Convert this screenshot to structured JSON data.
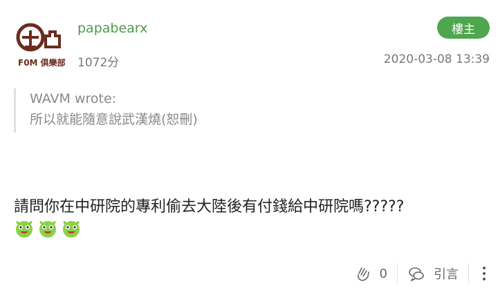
{
  "post": {
    "username": "papabearx",
    "points": "1072分",
    "floor_label": "樓主",
    "timestamp": "2020-03-08 13:39",
    "avatar_text": "F0M 俱樂部",
    "quote": {
      "author": "WAVM wrote:",
      "text": "所以就能隨意說武漢燒(恕刪)"
    },
    "content": "請問你在中研院的專利偷去大陸後有付錢給中研院嗎?????",
    "emojis": [
      "monster-emoji",
      "monster-emoji",
      "monster-emoji"
    ]
  },
  "actions": {
    "like_count": "0",
    "quote_label": "引言"
  },
  "colors": {
    "username": "#4e9a4e",
    "badge": "#4ea64e",
    "avatar_brand": "#6b2b1e"
  }
}
